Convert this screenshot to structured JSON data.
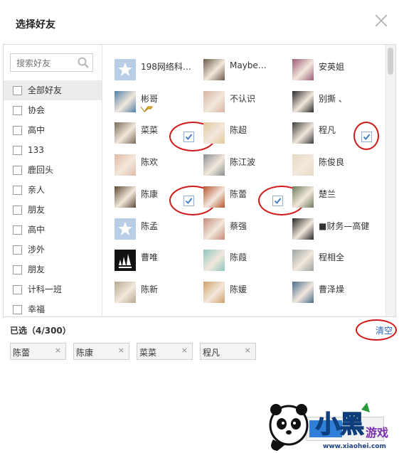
{
  "dialog": {
    "title": "选择好友",
    "close_icon": "close-icon"
  },
  "search": {
    "placeholder": "搜索好友",
    "icon": "search-icon"
  },
  "groups": [
    {
      "label": "全部好友",
      "active": true
    },
    {
      "label": "协会"
    },
    {
      "label": "高中"
    },
    {
      "label": "133"
    },
    {
      "label": "鹿回头"
    },
    {
      "label": "亲人"
    },
    {
      "label": "朋友"
    },
    {
      "label": "高中"
    },
    {
      "label": "涉外"
    },
    {
      "label": "朋友"
    },
    {
      "label": "计科一班"
    },
    {
      "label": "幸福"
    }
  ],
  "friends": [
    {
      "name": "198网络科…",
      "checked": false,
      "avatar": "star",
      "color": "#b9cde6"
    },
    {
      "name": "Maybe…",
      "checked": false,
      "avatar": "photo",
      "color": "#6b5a48"
    },
    {
      "name": "安英姐",
      "checked": false,
      "avatar": "photo",
      "color": "#9b5a78"
    },
    {
      "name": "彬哥",
      "checked": false,
      "avatar": "photo",
      "color": "#4f7fa8",
      "vip": true
    },
    {
      "name": "不认识",
      "checked": false,
      "avatar": "photo",
      "color": "#d8b4a2"
    },
    {
      "name": "别撕 、",
      "checked": false,
      "avatar": "photo",
      "color": "#2a2a2a"
    },
    {
      "name": "菜菜",
      "checked": true,
      "avatar": "photo",
      "color": "#7a6a58"
    },
    {
      "name": "陈超",
      "checked": false,
      "avatar": "photo",
      "color": "#e2c89b"
    },
    {
      "name": "程凡",
      "checked": true,
      "avatar": "photo",
      "color": "#3d3d3d"
    },
    {
      "name": "陈欢",
      "checked": false,
      "avatar": "photo",
      "color": "#e0b9a6"
    },
    {
      "name": "陈江波",
      "checked": false,
      "avatar": "photo",
      "color": "#8a8f92"
    },
    {
      "name": "陈俊良",
      "checked": false,
      "avatar": "photo",
      "color": "#e9d8c6"
    },
    {
      "name": "陈康",
      "checked": true,
      "avatar": "photo",
      "color": "#5e4a36"
    },
    {
      "name": "陈蕾",
      "checked": true,
      "avatar": "photo",
      "color": "#b8542f"
    },
    {
      "name": "楚兰",
      "checked": false,
      "avatar": "photo",
      "color": "#6c7a5a"
    },
    {
      "name": "陈孟",
      "checked": false,
      "avatar": "star",
      "color": "#b9cde6"
    },
    {
      "name": "蔡强",
      "checked": false,
      "avatar": "photo",
      "color": "#c88a7a"
    },
    {
      "name": "■财务—高健",
      "checked": false,
      "avatar": "photo",
      "color": "#262626"
    },
    {
      "name": "曹唯",
      "checked": false,
      "avatar": "adidas",
      "color": "#111111"
    },
    {
      "name": "陈葭",
      "checked": false,
      "avatar": "photo",
      "color": "#8ec6c0"
    },
    {
      "name": "程相全",
      "checked": false,
      "avatar": "photo",
      "color": "#9aa3a0"
    },
    {
      "name": "陈新",
      "checked": false,
      "avatar": "photo",
      "color": "#b7a98e"
    },
    {
      "name": "陈媛",
      "checked": false,
      "avatar": "photo",
      "color": "#d2a06a"
    },
    {
      "name": "曹泽燥",
      "checked": false,
      "avatar": "photo",
      "color": "#4a6b8c"
    }
  ],
  "selection": {
    "label": "已选（4/300）",
    "clear_label": "清空",
    "chips": [
      {
        "name": "陈蕾"
      },
      {
        "name": "陈康"
      },
      {
        "name": "菜菜"
      },
      {
        "name": "程凡"
      }
    ],
    "remove_glyph": "×"
  },
  "watermark": {
    "url": "www.xiaohei.com"
  },
  "colors": {
    "accent": "#2a63b8",
    "check": "#3a78c2",
    "annotation_ring": "#d01818"
  }
}
